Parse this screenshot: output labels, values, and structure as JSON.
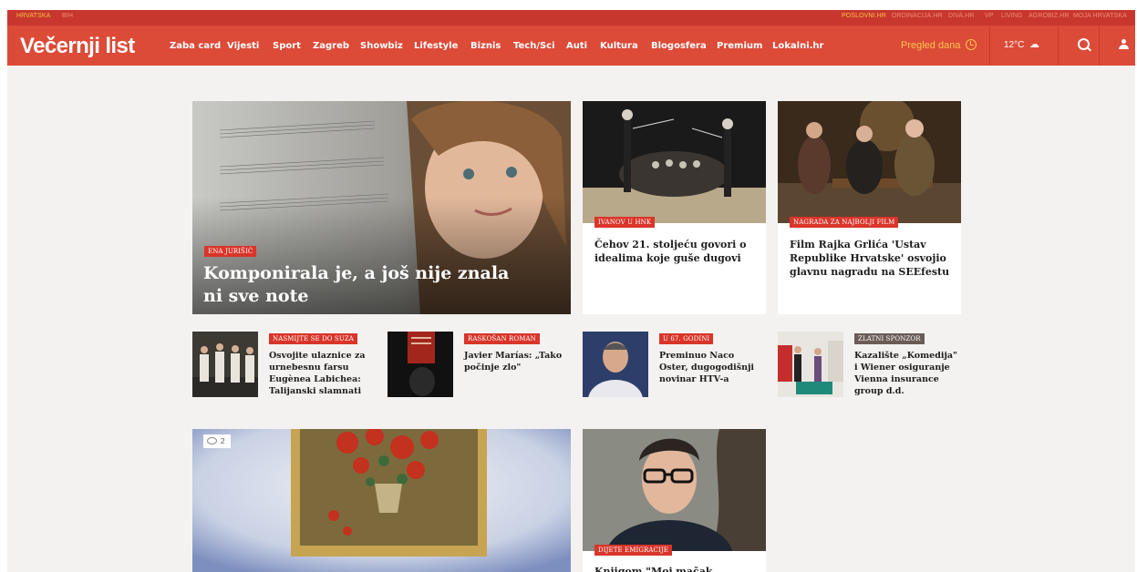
{
  "topbar": {
    "left": [
      "HRVATSKA",
      "BIH"
    ],
    "right": [
      "POSLOVNI.HR",
      "ORDINACIJA.HR",
      "DIVA.HR",
      "VP",
      "LIVING",
      "AGROBIZ.HR",
      "MOJA HRVATSKA"
    ]
  },
  "header": {
    "logo": "Večernji list",
    "nav": [
      "Zaba card",
      "Vijesti",
      "Sport",
      "Zagreb",
      "Showbiz",
      "Lifestyle",
      "Biznis",
      "Tech/Sci",
      "Auti",
      "Kultura",
      "Blogosfera",
      "Premium",
      "Lokalni.hr"
    ],
    "pregled": "Pregled dana",
    "temperature": "12°C",
    "icons": [
      "clock-icon",
      "cloud-rain-icon",
      "search-icon",
      "user-icon"
    ]
  },
  "articles": {
    "hero": {
      "label": "ENA JURIŠIĆ",
      "title": "Komponirala je, a još nije znala ni sve note"
    },
    "card1": {
      "label": "IVANOV U HNK",
      "title": "Čehov 21. stoljeću govori o idealima koje guše dugovi"
    },
    "card2": {
      "label": "NAGRADA ZA NAJBOLJI FILM",
      "title": "Film Rajka Grlića 'Ustav Republike Hrvatske' osvojio glavnu nagradu na SEEfestu"
    },
    "small1": {
      "label": "NASMIJTE SE DO SUZA",
      "title": "Osvojite ulaznice za urnebesnu farsu Eugènea Labichea: Talijanski slamnati"
    },
    "small2": {
      "label": "RASKOŠAN ROMAN",
      "title": "Javier Marías: „Tako počinje zlo\""
    },
    "small3": {
      "label": "U 67. GODINI",
      "title": "Preminuo Naco Oster, dugogodišnji novinar HTV-a"
    },
    "small4": {
      "label": "ZLATNI SPONZOR",
      "title": "Kazalište „Komedija\" i Wiener osiguranje Vienna insurance group d.d. nastavljaju"
    },
    "bottom1": {
      "comments": "2"
    },
    "bottom2": {
      "label": "DIJETE EMIGRACIJE",
      "title": "Knjigom \"Moj mačak"
    }
  },
  "colors": {
    "brand": "#dc4a38",
    "topbar": "#c8372e",
    "label": "#d9352a",
    "accent": "#f7c64a"
  }
}
